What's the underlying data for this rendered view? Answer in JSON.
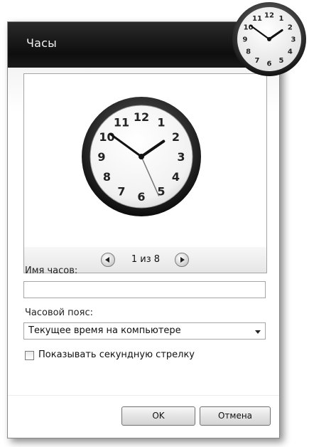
{
  "window": {
    "title": "Часы"
  },
  "preview": {
    "counter": "1 из 8"
  },
  "form": {
    "name_label": "Имя часов:",
    "name_value": "",
    "timezone_label": "Часовой пояс:",
    "timezone_value": "Текущее время на компьютере",
    "seconds_label": "Показывать секундную стрелку",
    "seconds_checked": false
  },
  "buttons": {
    "ok": "OK",
    "cancel": "Отмена"
  },
  "clock": {
    "numerals": [
      "12",
      "1",
      "2",
      "3",
      "4",
      "5",
      "6",
      "7",
      "8",
      "9",
      "10",
      "11"
    ],
    "time": {
      "hours": 1,
      "minutes": 51,
      "seconds": 26
    }
  },
  "icons": {
    "prev": "chevron-left-icon",
    "next": "chevron-right-icon",
    "dropdown": "chevron-down-icon"
  }
}
